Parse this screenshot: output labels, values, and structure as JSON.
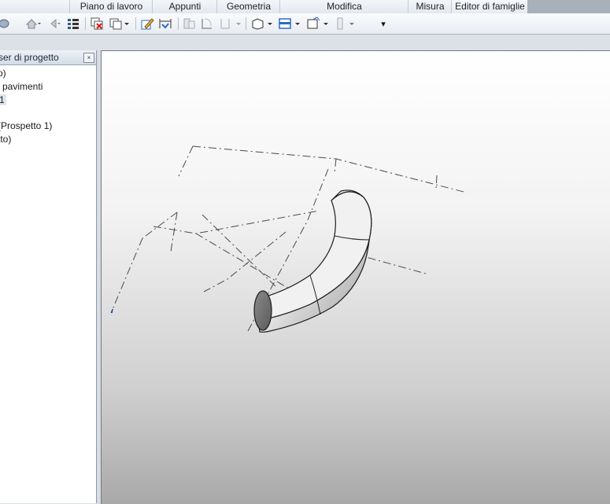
{
  "ribbon": {
    "panels": [
      "Piano di lavoro",
      "Appunti",
      "Geometria",
      "Modifica",
      "Misura",
      "Editor di famiglie"
    ],
    "overflow_glyph": "▾"
  },
  "browser": {
    "title": "ser di progetto",
    "pin_glyph": "ⓧ",
    "items": [
      "o)",
      "i pavimenti",
      "1",
      "(Prospetto 1)",
      "tto)"
    ]
  },
  "toolbar": {
    "icons": [
      "open-icon",
      "undo-icon",
      "redo-icon",
      "properties-icon",
      "close-hidden-icon",
      "switch-windows-icon",
      "edit-icon",
      "dimension-icon",
      "join-icon",
      "cut-icon",
      "split-icon",
      "workplane-icon",
      "default-3d-view-icon",
      "section-icon",
      "thin-lines-icon"
    ]
  }
}
